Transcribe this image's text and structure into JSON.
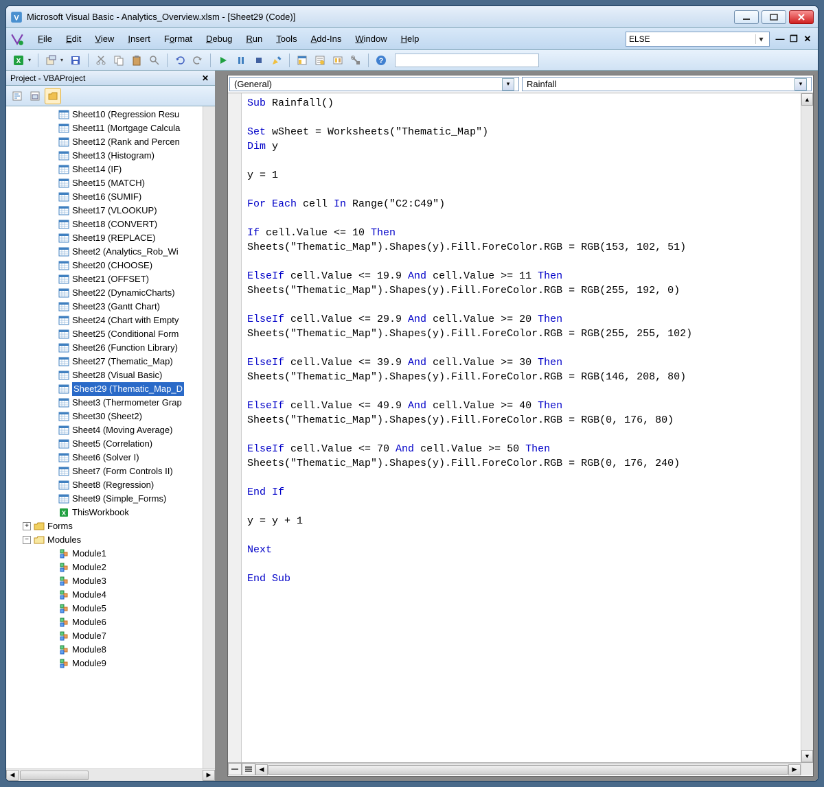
{
  "title": "Microsoft Visual Basic - Analytics_Overview.xlsm - [Sheet29 (Code)]",
  "menus": [
    {
      "label": "File",
      "u": 0
    },
    {
      "label": "Edit",
      "u": 0
    },
    {
      "label": "View",
      "u": 0
    },
    {
      "label": "Insert",
      "u": 0
    },
    {
      "label": "Format",
      "u": 1
    },
    {
      "label": "Debug",
      "u": 0
    },
    {
      "label": "Run",
      "u": 0
    },
    {
      "label": "Tools",
      "u": 0
    },
    {
      "label": "Add-Ins",
      "u": 0
    },
    {
      "label": "Window",
      "u": 0
    },
    {
      "label": "Help",
      "u": 0
    }
  ],
  "topCombo": "ELSE",
  "projectPaneTitle": "Project - VBAProject",
  "sheets": [
    "Sheet10 (Regression Resu",
    "Sheet11 (Mortgage Calcula",
    "Sheet12 (Rank and Percen",
    "Sheet13 (Histogram)",
    "Sheet14 (IF)",
    "Sheet15 (MATCH)",
    "Sheet16 (SUMIF)",
    "Sheet17 (VLOOKUP)",
    "Sheet18 (CONVERT)",
    "Sheet19 (REPLACE)",
    "Sheet2 (Analytics_Rob_Wi",
    "Sheet20 (CHOOSE)",
    "Sheet21 (OFFSET)",
    "Sheet22 (DynamicCharts)",
    "Sheet23 (Gantt Chart)",
    "Sheet24 (Chart with Empty",
    "Sheet25 (Conditional Form",
    "Sheet26 (Function Library)",
    "Sheet27 (Thematic_Map)",
    "Sheet28 (Visual Basic)",
    "Sheet29 (Thematic_Map_D",
    "Sheet3 (Thermometer Grap",
    "Sheet30 (Sheet2)",
    "Sheet4 (Moving Average)",
    "Sheet5 (Correlation)",
    "Sheet6 (Solver I)",
    "Sheet7 (Form Controls II)",
    "Sheet8 (Regression)",
    "Sheet9 (Simple_Forms)",
    "ThisWorkbook"
  ],
  "selectedSheet": "Sheet29 (Thematic_Map_D",
  "folders": [
    "Forms",
    "Modules"
  ],
  "modules": [
    "Module1",
    "Module2",
    "Module3",
    "Module4",
    "Module5",
    "Module6",
    "Module7",
    "Module8",
    "Module9"
  ],
  "objectCombo": "(General)",
  "procCombo": "Rainfall",
  "code": [
    {
      "t": "kw",
      "s": "Sub"
    },
    {
      "t": "x",
      "s": " Rainfall()"
    },
    {
      "t": "nl"
    },
    {
      "t": "nl"
    },
    {
      "t": "kw",
      "s": "Set"
    },
    {
      "t": "x",
      "s": " wSheet = Worksheets(\"Thematic_Map\")"
    },
    {
      "t": "nl"
    },
    {
      "t": "kw",
      "s": "Dim"
    },
    {
      "t": "x",
      "s": " y"
    },
    {
      "t": "nl"
    },
    {
      "t": "nl"
    },
    {
      "t": "x",
      "s": "y = 1"
    },
    {
      "t": "nl"
    },
    {
      "t": "nl"
    },
    {
      "t": "kw",
      "s": "For Each"
    },
    {
      "t": "x",
      "s": " cell "
    },
    {
      "t": "kw",
      "s": "In"
    },
    {
      "t": "x",
      "s": " Range(\"C2:C49\")"
    },
    {
      "t": "nl"
    },
    {
      "t": "nl"
    },
    {
      "t": "kw",
      "s": "If"
    },
    {
      "t": "x",
      "s": " cell.Value <= 10 "
    },
    {
      "t": "kw",
      "s": "Then"
    },
    {
      "t": "nl"
    },
    {
      "t": "x",
      "s": "Sheets(\"Thematic_Map\").Shapes(y).Fill.ForeColor.RGB = RGB(153, 102, 51)"
    },
    {
      "t": "nl"
    },
    {
      "t": "nl"
    },
    {
      "t": "kw",
      "s": "ElseIf"
    },
    {
      "t": "x",
      "s": " cell.Value <= 19.9 "
    },
    {
      "t": "kw",
      "s": "And"
    },
    {
      "t": "x",
      "s": " cell.Value >= 11 "
    },
    {
      "t": "kw",
      "s": "Then"
    },
    {
      "t": "nl"
    },
    {
      "t": "x",
      "s": "Sheets(\"Thematic_Map\").Shapes(y).Fill.ForeColor.RGB = RGB(255, 192, 0)"
    },
    {
      "t": "nl"
    },
    {
      "t": "nl"
    },
    {
      "t": "kw",
      "s": "ElseIf"
    },
    {
      "t": "x",
      "s": " cell.Value <= 29.9 "
    },
    {
      "t": "kw",
      "s": "And"
    },
    {
      "t": "x",
      "s": " cell.Value >= 20 "
    },
    {
      "t": "kw",
      "s": "Then"
    },
    {
      "t": "nl"
    },
    {
      "t": "x",
      "s": "Sheets(\"Thematic_Map\").Shapes(y).Fill.ForeColor.RGB = RGB(255, 255, 102)"
    },
    {
      "t": "nl"
    },
    {
      "t": "nl"
    },
    {
      "t": "kw",
      "s": "ElseIf"
    },
    {
      "t": "x",
      "s": " cell.Value <= 39.9 "
    },
    {
      "t": "kw",
      "s": "And"
    },
    {
      "t": "x",
      "s": " cell.Value >= 30 "
    },
    {
      "t": "kw",
      "s": "Then"
    },
    {
      "t": "nl"
    },
    {
      "t": "x",
      "s": "Sheets(\"Thematic_Map\").Shapes(y).Fill.ForeColor.RGB = RGB(146, 208, 80)"
    },
    {
      "t": "nl"
    },
    {
      "t": "nl"
    },
    {
      "t": "kw",
      "s": "ElseIf"
    },
    {
      "t": "x",
      "s": " cell.Value <= 49.9 "
    },
    {
      "t": "kw",
      "s": "And"
    },
    {
      "t": "x",
      "s": " cell.Value >= 40 "
    },
    {
      "t": "kw",
      "s": "Then"
    },
    {
      "t": "nl"
    },
    {
      "t": "x",
      "s": "Sheets(\"Thematic_Map\").Shapes(y).Fill.ForeColor.RGB = RGB(0, 176, 80)"
    },
    {
      "t": "nl"
    },
    {
      "t": "nl"
    },
    {
      "t": "kw",
      "s": "ElseIf"
    },
    {
      "t": "x",
      "s": " cell.Value <= 70 "
    },
    {
      "t": "kw",
      "s": "And"
    },
    {
      "t": "x",
      "s": " cell.Value >= 50 "
    },
    {
      "t": "kw",
      "s": "Then"
    },
    {
      "t": "nl"
    },
    {
      "t": "x",
      "s": "Sheets(\"Thematic_Map\").Shapes(y).Fill.ForeColor.RGB = RGB(0, 176, 240)"
    },
    {
      "t": "nl"
    },
    {
      "t": "nl"
    },
    {
      "t": "kw",
      "s": "End If"
    },
    {
      "t": "nl"
    },
    {
      "t": "nl"
    },
    {
      "t": "x",
      "s": "y = y + 1"
    },
    {
      "t": "nl"
    },
    {
      "t": "nl"
    },
    {
      "t": "kw",
      "s": "Next"
    },
    {
      "t": "nl"
    },
    {
      "t": "nl"
    },
    {
      "t": "kw",
      "s": "End Sub"
    },
    {
      "t": "nl"
    }
  ]
}
